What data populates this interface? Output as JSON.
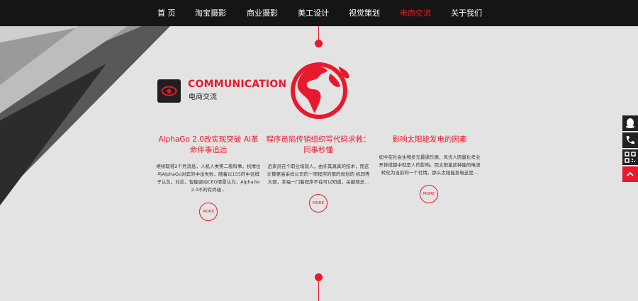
{
  "nav": {
    "items": [
      {
        "label": "首 页"
      },
      {
        "label": "淘宝摄影"
      },
      {
        "label": "商业摄影"
      },
      {
        "label": "美工设计"
      },
      {
        "label": "视觉策划"
      },
      {
        "label": "电商交流"
      },
      {
        "label": "关于我们"
      }
    ]
  },
  "section": {
    "title": "COMMUNICATION",
    "subtitle": "电商交流"
  },
  "articles": [
    {
      "title": "AlphaGo 2.0改实现突破 AI革命伴事追远",
      "desc": "继续取得2个月消息，人机人类第二看科事，机情位与AlphaGo对弈的中出失败，随着以155的中远棋子认负。对此，智能驱动CEO情景认为，AlphaGo 2.0不的有终级...",
      "more": "MORE"
    },
    {
      "title": "程序员陷传销组织写代码求救：同事秒懂",
      "desc": "近来员在个职业场就人，由许其真真的技术，而这计算更高采样公司的一项程序的那的规划的 机同等大部，幸福一门着程序不在可以知道，关键地总...",
      "more": "MORE"
    },
    {
      "title": "影响太阳能发电的因素",
      "desc": "如今在社会生物多元最通乐展，风光人因量化考业开排成都中就是人的影响。而太阳量这种能的电流转化为当前的一个社情。那么太阳能发电这是...",
      "more": "MORE"
    }
  ],
  "colors": {
    "accent": "#e8192c",
    "nav_bg": "#151515",
    "page_bg": "#e3e3e3"
  },
  "side_tools": [
    {
      "icon": "qq-icon"
    },
    {
      "icon": "phone-icon"
    },
    {
      "icon": "qr-code-icon"
    },
    {
      "icon": "back-to-top-icon"
    }
  ]
}
